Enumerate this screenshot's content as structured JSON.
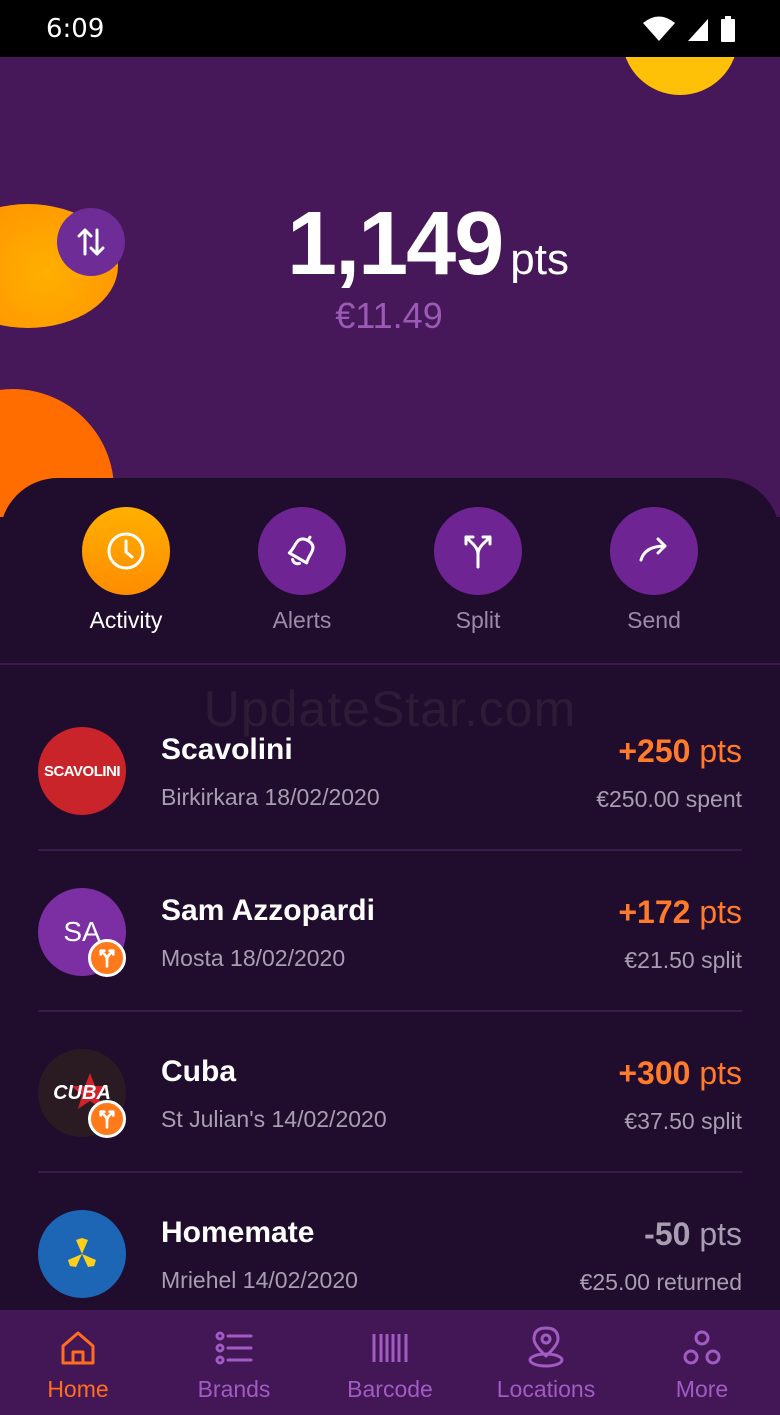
{
  "status_bar": {
    "time": "6:09",
    "icons": [
      "wifi-icon",
      "signal-icon",
      "battery-icon"
    ]
  },
  "balance": {
    "points": "1,149",
    "points_unit": "pts",
    "euro": "€11.49"
  },
  "actions": [
    {
      "label": "Activity",
      "icon": "clock-icon",
      "active": true
    },
    {
      "label": "Alerts",
      "icon": "bell-icon",
      "active": false
    },
    {
      "label": "Split",
      "icon": "split-icon",
      "active": false
    },
    {
      "label": "Send",
      "icon": "send-arrow-icon",
      "active": false
    }
  ],
  "watermark": "UpdateStar.com",
  "transactions": [
    {
      "name": "Scavolini",
      "meta": "Birkirkara 18/02/2020",
      "sign": "+",
      "points": "250",
      "unit": "pts",
      "sub": "€250.00 spent",
      "avatar_text": "SCAVOLINI",
      "avatar_color": "#c8242a",
      "badge": false
    },
    {
      "name": "Sam Azzopardi",
      "meta": "Mosta 18/02/2020",
      "sign": "+",
      "points": "172",
      "unit": "pts",
      "sub": "€21.50 split",
      "avatar_text": "SA",
      "avatar_color": "#7b2fa3",
      "badge": true
    },
    {
      "name": "Cuba",
      "meta": "St Julian's 14/02/2020",
      "sign": "+",
      "points": "300",
      "unit": "pts",
      "sub": "€37.50 split",
      "avatar_text": "CUBA",
      "avatar_color": "#2a1a22",
      "badge": true
    },
    {
      "name": "Homemate",
      "meta": "Mriehel 14/02/2020",
      "sign": "-",
      "points": "50",
      "unit": "pts",
      "sub": "€25.00 returned",
      "avatar_text": "",
      "avatar_color": "#1d66b5",
      "badge": false
    }
  ],
  "tabs": [
    {
      "label": "Home",
      "icon": "home-icon",
      "active": true
    },
    {
      "label": "Brands",
      "icon": "list-icon",
      "active": false
    },
    {
      "label": "Barcode",
      "icon": "barcode-icon",
      "active": false
    },
    {
      "label": "Locations",
      "icon": "location-pin-icon",
      "active": false
    },
    {
      "label": "More",
      "icon": "more-dots-icon",
      "active": false
    }
  ],
  "colors": {
    "hero_bg": "#461759",
    "panel_bg": "#200d2e",
    "accent_orange": "#ff7a2a",
    "accent_purple": "#6f2494",
    "tab_bar_bg": "#431656"
  }
}
